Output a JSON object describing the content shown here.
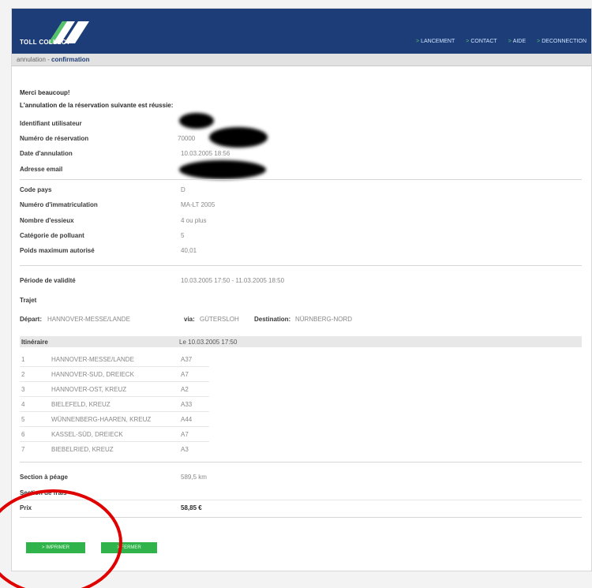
{
  "header": {
    "logo_text": "TOLL COLLECT",
    "nav": [
      {
        "label": "LANCEMENT",
        "arrow": ">"
      },
      {
        "label": "CONTACT",
        "arrow": ">"
      },
      {
        "label": "AIDE",
        "arrow": ">"
      },
      {
        "label": "DECONNECTION",
        "arrow": ">"
      }
    ]
  },
  "breadcrumb": {
    "parent": "annulation - ",
    "current": "confirmation"
  },
  "message": {
    "thanks": "Merci beaucoup!",
    "success": "L'annulation de la réservation suivante est réussie:"
  },
  "fields": {
    "user_id_label": "Identifiant utilisateur",
    "booking_no_label": "Numéro de réservation",
    "booking_no_value": "70000",
    "cancel_date_label": "Date d'annulation",
    "cancel_date_value": "10.03.2005 18:56",
    "email_label": "Adresse email",
    "country_label": "Code pays",
    "country_value": "D",
    "reg_no_label": "Numéro d'immatriculation",
    "reg_no_value": "MA-LT 2005",
    "axles_label": "Nombre d'essieux",
    "axles_value": "4 ou plus",
    "emission_label": "Catégorie de polluant",
    "emission_value": "5",
    "weight_label": "Poids maximum autorisé",
    "weight_value": "40,01",
    "validity_label": "Période de validité",
    "validity_value": "10.03.2005 17:50 - 11.03.2005 18:50",
    "route_label": "Trajet",
    "departure_label": "Départ:",
    "departure_value": "HANNOVER-MESSE/LANDE",
    "via_label": "via:",
    "via_value": "GÜTERSLOH",
    "destination_label": "Destination:",
    "destination_value": "NÜRNBERG-NORD"
  },
  "itinerary": {
    "header_label": "Itinéraire",
    "header_date": "Le 10.03.2005 17:50",
    "rows": [
      {
        "num": "1",
        "name": "HANNOVER-MESSE/LANDE",
        "road": "A37"
      },
      {
        "num": "2",
        "name": "HANNOVER-SUD, DREIECK",
        "road": "A7"
      },
      {
        "num": "3",
        "name": "HANNOVER-OST, KREUZ",
        "road": "A2"
      },
      {
        "num": "4",
        "name": "BIELEFELD, KREUZ",
        "road": "A33"
      },
      {
        "num": "5",
        "name": "WÜNNENBERG-HAAREN, KREUZ",
        "road": "A44"
      },
      {
        "num": "6",
        "name": "KASSEL-SÜD, DREIECK",
        "road": "A7"
      },
      {
        "num": "7",
        "name": "BIEBELRIED, KREUZ",
        "road": "A3"
      }
    ]
  },
  "summary": {
    "toll_section_label": "Section à péage",
    "toll_section_value": "589,5 km",
    "fee_section_label": "Section de frais",
    "price_label": "Prix",
    "price_value": "58,85 €"
  },
  "buttons": {
    "print_label": "> IMPRIMER",
    "close_label": "> FERMER"
  },
  "colors": {
    "header": "#1d3d78",
    "button": "#2fb34a",
    "annotation_circle": "#e00000"
  }
}
